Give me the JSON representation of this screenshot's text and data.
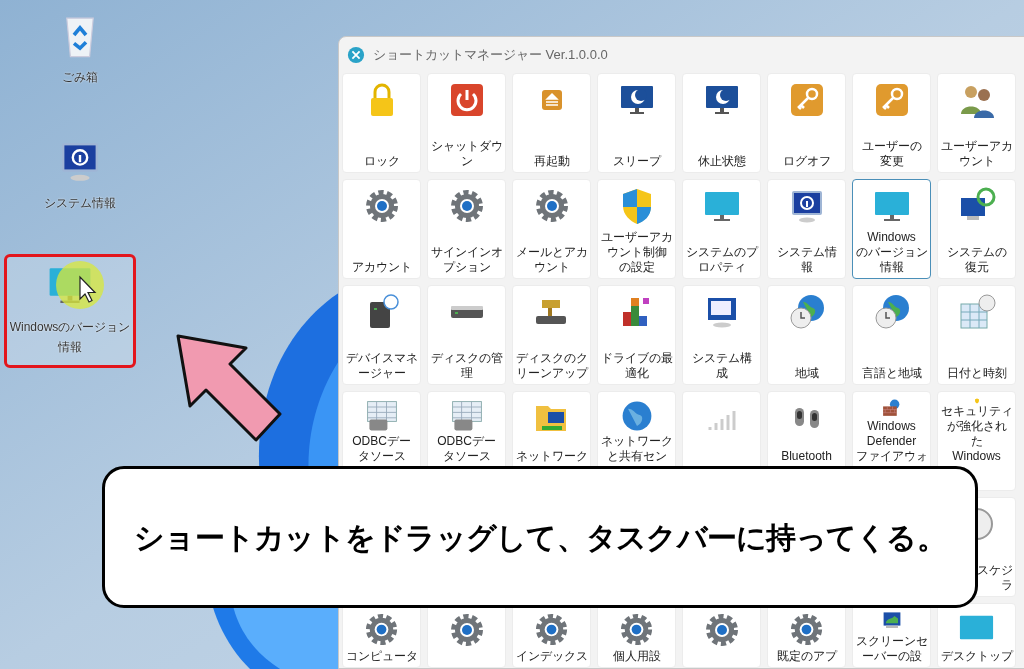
{
  "desktop": {
    "icons": [
      {
        "lines": [
          "ごみ箱"
        ],
        "kind": "recycle-bin",
        "highlighted": false
      },
      {
        "lines": [
          "システム情報"
        ],
        "kind": "info-monitor",
        "highlighted": false
      },
      {
        "lines": [
          "Windowsのバージョン",
          "情報"
        ],
        "kind": "monitor",
        "highlighted": true
      }
    ]
  },
  "window": {
    "title": "ショートカットマネージャー Ver.1.0.0.0",
    "rows": [
      [
        {
          "lines": [
            "ロック"
          ],
          "kind": "lock",
          "selected": false
        },
        {
          "lines": [
            "シャットダウ",
            "ン"
          ],
          "kind": "power",
          "selected": false
        },
        {
          "lines": [
            "再起動"
          ],
          "kind": "eject",
          "selected": false
        },
        {
          "lines": [
            "スリープ"
          ],
          "kind": "moon-monitor",
          "selected": false
        },
        {
          "lines": [
            "休止状態"
          ],
          "kind": "moon-monitor",
          "selected": false
        },
        {
          "lines": [
            "ログオフ"
          ],
          "kind": "key",
          "selected": false
        },
        {
          "lines": [
            "ユーザーの",
            "変更"
          ],
          "kind": "key",
          "selected": false
        },
        {
          "lines": [
            "ユーザーアカ",
            "ウント"
          ],
          "kind": "users",
          "selected": false
        }
      ],
      [
        {
          "lines": [
            "アカウント"
          ],
          "kind": "gear",
          "selected": false
        },
        {
          "lines": [
            "サインインオ",
            "プション"
          ],
          "kind": "gear",
          "selected": false
        },
        {
          "lines": [
            "メールとアカ",
            "ウント"
          ],
          "kind": "gear",
          "selected": false
        },
        {
          "lines": [
            "ユーザーアカ",
            "ウント制御",
            "の設定"
          ],
          "kind": "shield",
          "selected": false
        },
        {
          "lines": [
            "システムのプ",
            "ロパティ"
          ],
          "kind": "monitor",
          "selected": false
        },
        {
          "lines": [
            "システム情",
            "報"
          ],
          "kind": "info-monitor",
          "selected": false
        },
        {
          "lines": [
            "Windows",
            "のバージョン",
            "情報"
          ],
          "kind": "monitor",
          "selected": true
        },
        {
          "lines": [
            "システムの",
            "復元"
          ],
          "kind": "restore",
          "selected": false
        }
      ],
      [
        {
          "lines": [
            "デバイスマネ",
            "ージャー"
          ],
          "kind": "drive-question",
          "selected": false
        },
        {
          "lines": [
            "ディスクの管",
            "理"
          ],
          "kind": "drive",
          "selected": false
        },
        {
          "lines": [
            "ディスクのク",
            "リーンアップ"
          ],
          "kind": "brush-drive",
          "selected": false
        },
        {
          "lines": [
            "ドライブの最",
            "適化"
          ],
          "kind": "blocks",
          "selected": false
        },
        {
          "lines": [
            "システム構",
            "成"
          ],
          "kind": "window-monitor",
          "selected": false
        },
        {
          "lines": [
            "地域"
          ],
          "kind": "globe-clock",
          "selected": false
        },
        {
          "lines": [
            "言語と地域"
          ],
          "kind": "globe-clock",
          "selected": false
        },
        {
          "lines": [
            "日付と時刻"
          ],
          "kind": "calendar",
          "selected": false
        }
      ],
      [
        {
          "lines": [
            "ODBCデー",
            "タソース"
          ],
          "kind": "table",
          "selected": false
        },
        {
          "lines": [
            "ODBCデー",
            "タソース"
          ],
          "kind": "table",
          "selected": false
        },
        {
          "lines": [
            "ネットワーク"
          ],
          "kind": "network-folder",
          "selected": false
        },
        {
          "lines": [
            "ネットワーク",
            "と共有セン"
          ],
          "kind": "globe",
          "selected": false
        },
        {
          "kind": "bars",
          "selected": false
        },
        {
          "lines": [
            "Bluetooth"
          ],
          "kind": "earbuds",
          "selected": false
        },
        {
          "lines": [
            "Windows",
            "Defender",
            "ファイアウォ"
          ],
          "kind": "wall",
          "selected": false
        },
        {
          "lines": [
            "セキュリティ",
            "が強化され",
            "た",
            "Windows"
          ],
          "kind": "shield-yellow",
          "selected": false
        }
      ],
      [
        "",
        "",
        "",
        "",
        "",
        "",
        "",
        {
          "lines": [
            "スケジ",
            "ラ"
          ],
          "kind": "clock",
          "selected": false
        }
      ],
      [
        {
          "lines": [
            "コンピュータ"
          ],
          "kind": "gear",
          "selected": false
        },
        {
          "kind": "gear",
          "selected": false
        },
        {
          "lines": [
            "インデックス"
          ],
          "kind": "gear",
          "selected": false
        },
        {
          "lines": [
            "個人用設"
          ],
          "kind": "gear",
          "selected": false
        },
        {
          "kind": "gear",
          "selected": false
        },
        {
          "lines": [
            "既定のアプ"
          ],
          "kind": "gear",
          "selected": false
        },
        {
          "lines": [
            "スクリーンセ",
            "ーバーの設"
          ],
          "kind": "landscape-monitor",
          "selected": false
        },
        {
          "lines": [
            "デスクトップ"
          ],
          "kind": "desktop",
          "selected": false
        }
      ]
    ]
  },
  "caption": {
    "text": "ショートカットをドラッグして、タスクバーに持ってくる。"
  }
}
